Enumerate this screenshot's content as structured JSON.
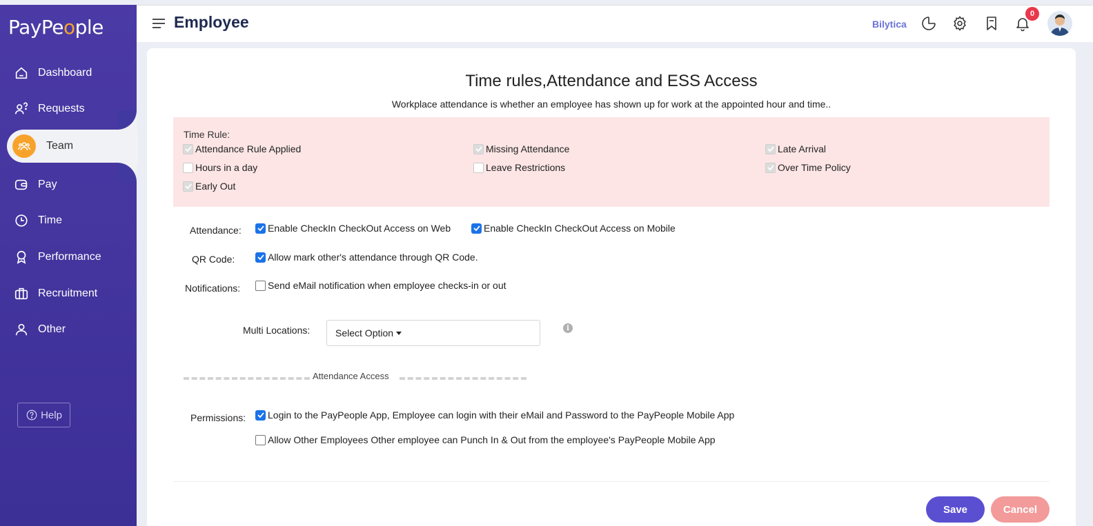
{
  "app": {
    "logo_prefix": "PayPe",
    "logo_dot": "o",
    "logo_suffix": "ple"
  },
  "sidebar": {
    "items": [
      {
        "label": "Dashboard",
        "icon": "home-icon"
      },
      {
        "label": "Requests",
        "icon": "person-question-icon"
      },
      {
        "label": "Team",
        "icon": "team-icon",
        "active": true
      },
      {
        "label": "Pay",
        "icon": "wallet-icon"
      },
      {
        "label": "Time",
        "icon": "clock-icon"
      },
      {
        "label": "Performance",
        "icon": "award-icon"
      },
      {
        "label": "Recruitment",
        "icon": "briefcase-icon"
      },
      {
        "label": "Other",
        "icon": "user-icon"
      }
    ],
    "help_label": "Help"
  },
  "header": {
    "title": "Employee",
    "company": "Bilytica",
    "notification_count": "0"
  },
  "main": {
    "title": "Time rules,Attendance and ESS Access",
    "subtitle": "Workplace attendance is whether an employee has shown up for work at the appointed hour and time..",
    "time_rule": {
      "label": "Time Rule:",
      "items": [
        {
          "label": "Attendance Rule Applied",
          "checked": true
        },
        {
          "label": "Missing Attendance",
          "checked": true
        },
        {
          "label": "Late Arrival",
          "checked": true
        },
        {
          "label": " Hours in a day",
          "checked": false
        },
        {
          "label": " Leave Restrictions",
          "checked": false
        },
        {
          "label": "Over Time Policy",
          "checked": true
        },
        {
          "label": "Early Out",
          "checked": true
        }
      ]
    },
    "attendance": {
      "label": "Attendance:",
      "web": "Enable CheckIn CheckOut Access on Web",
      "mobile": "Enable CheckIn CheckOut Access on Mobile"
    },
    "qr": {
      "label": "QR Code:",
      "text": "Allow mark other's attendance through QR Code."
    },
    "notifications": {
      "label": "Notifications:",
      "text": "Send eMail notification when employee checks-in or out"
    },
    "multi_locations": {
      "label": "Multi Locations:",
      "value": "Select Option"
    },
    "divider": "Attendance Access",
    "permissions": {
      "label": "Permissions:",
      "login": " Login to the PayPeople App, Employee can login with their eMail and Password to the PayPeople Mobile App",
      "allow_other": " Allow Other Employees Other employee can Punch In & Out from the employee's PayPeople Mobile App"
    },
    "save_label": "Save",
    "cancel_label": "Cancel"
  },
  "colors": {
    "sidebar": "#4239a0",
    "accent": "#f7a32b",
    "save": "#5b4fd1",
    "cancel": "#f39a9a",
    "pink": "#fde5e5"
  }
}
